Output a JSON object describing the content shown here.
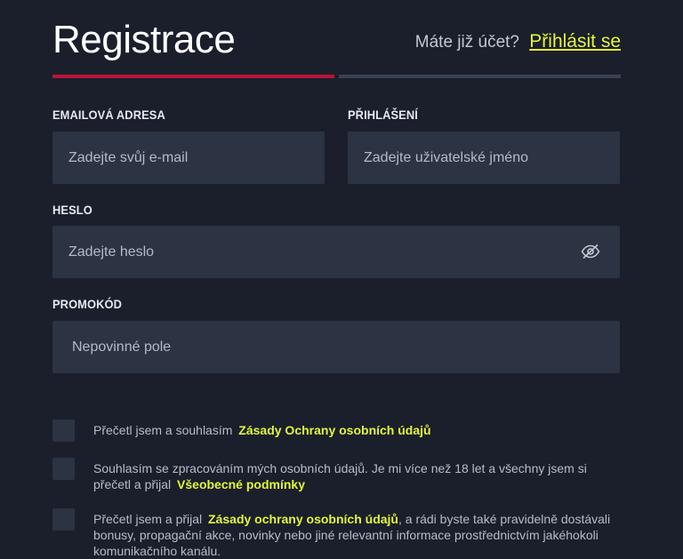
{
  "header": {
    "title": "Registrace",
    "account_question": "Máte již účet?",
    "login_link": "Přihlásit se"
  },
  "form": {
    "email": {
      "label": "EMAILOVÁ ADRESA",
      "placeholder": "Zadejte svůj e-mail",
      "value": ""
    },
    "username": {
      "label": "PŘIHLÁŠENÍ",
      "placeholder": "Zadejte uživatelské jméno",
      "value": ""
    },
    "password": {
      "label": "HESLO",
      "placeholder": "Zadejte heslo",
      "value": "",
      "toggle_icon": "eye-slash-icon"
    },
    "promo": {
      "label": "PROMOKÓD",
      "placeholder": "Nepovinné pole",
      "value": ""
    }
  },
  "consents": [
    {
      "text": "Přečetl jsem a souhlasím",
      "link": "Zásady Ochrany osobních údajů",
      "text_after": "",
      "checked": false
    },
    {
      "text": "Souhlasím se zpracováním mých osobních údajů. Je mi více než 18 let a všechny jsem si přečetl a přijal",
      "link": "Všeobecné podmínky",
      "text_after": "",
      "checked": false
    },
    {
      "text": "Přečetl jsem a přijal",
      "link": "Zásady ochrany osobních údajů",
      "text_after": ", a rádi byste také pravidelně dostávali bonusy, propagační akce, novinky nebo jiné relevantní informace prostřednictvím jakéhokoli komunikačního kanálu.",
      "checked": false
    }
  ],
  "colors": {
    "background": "#1b1f2b",
    "field_background": "#2c3342",
    "accent_link": "#e3f53c",
    "step_active": "#b8143a",
    "step_inactive": "#394252"
  }
}
